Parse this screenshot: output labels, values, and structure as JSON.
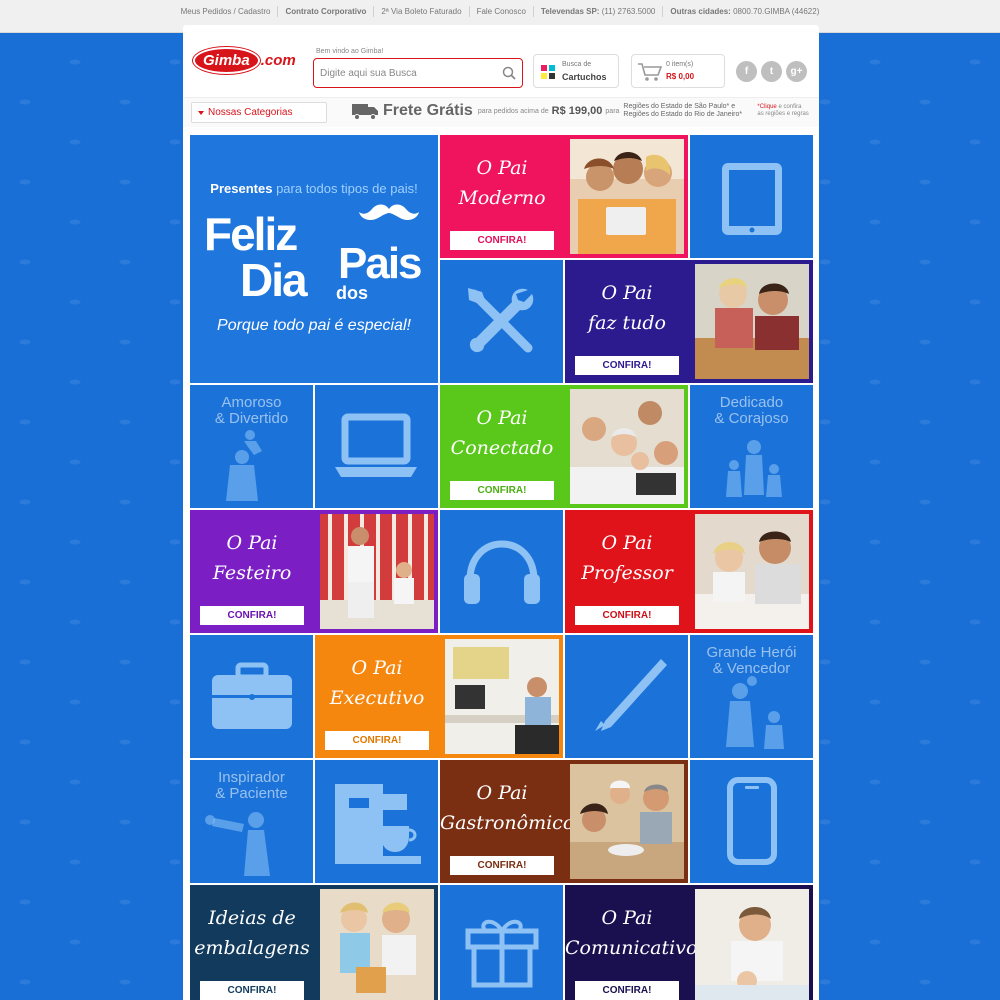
{
  "topbar": {
    "links": [
      "Meus Pedidos / Cadastro",
      "Contrato Corporativo",
      "2ª Via Boleto Faturado",
      "Fale Conosco"
    ],
    "televendas_label": "Televendas SP:",
    "televendas_phone": "(11) 2763.5000",
    "outras_label": "Outras cidades:",
    "outras_phone": "0800.70.GIMBA (44622)"
  },
  "header": {
    "logo_main": "Gimba",
    "logo_suffix": ".com",
    "welcome": "Bem vindo ao Gimba!",
    "search_placeholder": "Digite aqui sua Busca",
    "cartuchos_line1": "Busca de",
    "cartuchos_line2": "Cartuchos",
    "cart_items": "0 item(s)",
    "cart_total": "R$ 0,00",
    "social": [
      "f",
      "t",
      "g+"
    ]
  },
  "subbar": {
    "categories_label": "Nossas Categorias",
    "frete_title": "Frete Grátis",
    "frete_prefix": "para pedidos acima de",
    "frete_value": "R$ 199,00",
    "frete_suffix": "para",
    "region_1": "Regiões do Estado de São Paulo* e",
    "region_2": "Regiões do Estado do Rio de Janeiro*",
    "note_link": "*Clique",
    "note_text": "e confira as regiões e regras"
  },
  "hero": {
    "subtitle_bold": "Presentes",
    "subtitle_rest": "para todos tipos de pais!",
    "feliz": "Feliz",
    "dia": "Dia",
    "dos": "dos",
    "pais": "Pais",
    "tagline": "Porque todo pai é especial!"
  },
  "tiles_text": {
    "amoroso": [
      "Amoroso",
      "& Divertido"
    ],
    "dedicado": [
      "Dedicado",
      "& Corajoso"
    ],
    "heroi": [
      "Grande Herói",
      "& Vencedor"
    ],
    "inspirador": [
      "Inspirador",
      "& Paciente"
    ]
  },
  "promos": {
    "moderno": {
      "line1": "O Pai",
      "line2": "Moderno",
      "button": "CONFIRA!",
      "color": "#f0145f",
      "btn_text_color": "#e0105a"
    },
    "faz_tudo": {
      "line1": "O Pai",
      "line2": "faz tudo",
      "button": "CONFIRA!",
      "color": "#2c1a8f",
      "btn_text_color": "#2c1a8f"
    },
    "conectado": {
      "line1": "O Pai",
      "line2": "Conectado",
      "button": "CONFIRA!",
      "color": "#5ac81a",
      "btn_text_color": "#4cae12"
    },
    "festeiro": {
      "line1": "O Pai",
      "line2": "Festeiro",
      "button": "CONFIRA!",
      "color": "#7b1fc4",
      "btn_text_color": "#6a12b0"
    },
    "professor": {
      "line1": "O Pai",
      "line2": "Professor",
      "button": "CONFIRA!",
      "color": "#e0121a",
      "btn_text_color": "#cc1018"
    },
    "executivo": {
      "line1": "O Pai",
      "line2": "Executivo",
      "button": "CONFIRA!",
      "color": "#f5870f",
      "btn_text_color": "#e07800"
    },
    "gastronomico": {
      "line1": "O Pai",
      "line2": "Gastronômico",
      "button": "CONFIRA!",
      "color": "#7a2e12",
      "btn_text_color": "#7a2e12"
    },
    "embalagens": {
      "line1": "Ideias de",
      "line2": "embalagens",
      "button": "CONFIRA!",
      "color": "#123a5c",
      "btn_text_color": "#123a5c"
    },
    "comunicativo": {
      "line1": "O Pai",
      "line2": "Comunicativo",
      "button": "CONFIRA!",
      "color": "#1a1050",
      "btn_text_color": "#1a1050"
    }
  },
  "colors": {
    "brand_red": "#d8141b",
    "tile_blue": "#1b73d9",
    "page_blue": "#1a6fd6"
  },
  "icons": [
    "search-icon",
    "cartridge-icon",
    "shopping-cart-icon",
    "truck-icon",
    "mustache-icon",
    "tablet-icon",
    "tools-icon",
    "laptop-icon",
    "headphones-icon",
    "briefcase-icon",
    "pen-icon",
    "coffee-machine-icon",
    "smartphone-icon",
    "gift-icon"
  ]
}
